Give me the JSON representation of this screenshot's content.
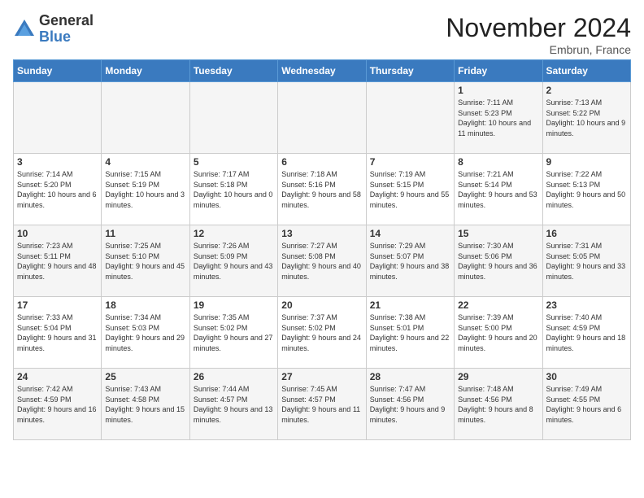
{
  "logo": {
    "general": "General",
    "blue": "Blue"
  },
  "title": "November 2024",
  "location": "Embrun, France",
  "days_of_week": [
    "Sunday",
    "Monday",
    "Tuesday",
    "Wednesday",
    "Thursday",
    "Friday",
    "Saturday"
  ],
  "weeks": [
    [
      {
        "num": "",
        "content": ""
      },
      {
        "num": "",
        "content": ""
      },
      {
        "num": "",
        "content": ""
      },
      {
        "num": "",
        "content": ""
      },
      {
        "num": "",
        "content": ""
      },
      {
        "num": "1",
        "content": "Sunrise: 7:11 AM\nSunset: 5:23 PM\nDaylight: 10 hours and 11 minutes."
      },
      {
        "num": "2",
        "content": "Sunrise: 7:13 AM\nSunset: 5:22 PM\nDaylight: 10 hours and 9 minutes."
      }
    ],
    [
      {
        "num": "3",
        "content": "Sunrise: 7:14 AM\nSunset: 5:20 PM\nDaylight: 10 hours and 6 minutes."
      },
      {
        "num": "4",
        "content": "Sunrise: 7:15 AM\nSunset: 5:19 PM\nDaylight: 10 hours and 3 minutes."
      },
      {
        "num": "5",
        "content": "Sunrise: 7:17 AM\nSunset: 5:18 PM\nDaylight: 10 hours and 0 minutes."
      },
      {
        "num": "6",
        "content": "Sunrise: 7:18 AM\nSunset: 5:16 PM\nDaylight: 9 hours and 58 minutes."
      },
      {
        "num": "7",
        "content": "Sunrise: 7:19 AM\nSunset: 5:15 PM\nDaylight: 9 hours and 55 minutes."
      },
      {
        "num": "8",
        "content": "Sunrise: 7:21 AM\nSunset: 5:14 PM\nDaylight: 9 hours and 53 minutes."
      },
      {
        "num": "9",
        "content": "Sunrise: 7:22 AM\nSunset: 5:13 PM\nDaylight: 9 hours and 50 minutes."
      }
    ],
    [
      {
        "num": "10",
        "content": "Sunrise: 7:23 AM\nSunset: 5:11 PM\nDaylight: 9 hours and 48 minutes."
      },
      {
        "num": "11",
        "content": "Sunrise: 7:25 AM\nSunset: 5:10 PM\nDaylight: 9 hours and 45 minutes."
      },
      {
        "num": "12",
        "content": "Sunrise: 7:26 AM\nSunset: 5:09 PM\nDaylight: 9 hours and 43 minutes."
      },
      {
        "num": "13",
        "content": "Sunrise: 7:27 AM\nSunset: 5:08 PM\nDaylight: 9 hours and 40 minutes."
      },
      {
        "num": "14",
        "content": "Sunrise: 7:29 AM\nSunset: 5:07 PM\nDaylight: 9 hours and 38 minutes."
      },
      {
        "num": "15",
        "content": "Sunrise: 7:30 AM\nSunset: 5:06 PM\nDaylight: 9 hours and 36 minutes."
      },
      {
        "num": "16",
        "content": "Sunrise: 7:31 AM\nSunset: 5:05 PM\nDaylight: 9 hours and 33 minutes."
      }
    ],
    [
      {
        "num": "17",
        "content": "Sunrise: 7:33 AM\nSunset: 5:04 PM\nDaylight: 9 hours and 31 minutes."
      },
      {
        "num": "18",
        "content": "Sunrise: 7:34 AM\nSunset: 5:03 PM\nDaylight: 9 hours and 29 minutes."
      },
      {
        "num": "19",
        "content": "Sunrise: 7:35 AM\nSunset: 5:02 PM\nDaylight: 9 hours and 27 minutes."
      },
      {
        "num": "20",
        "content": "Sunrise: 7:37 AM\nSunset: 5:02 PM\nDaylight: 9 hours and 24 minutes."
      },
      {
        "num": "21",
        "content": "Sunrise: 7:38 AM\nSunset: 5:01 PM\nDaylight: 9 hours and 22 minutes."
      },
      {
        "num": "22",
        "content": "Sunrise: 7:39 AM\nSunset: 5:00 PM\nDaylight: 9 hours and 20 minutes."
      },
      {
        "num": "23",
        "content": "Sunrise: 7:40 AM\nSunset: 4:59 PM\nDaylight: 9 hours and 18 minutes."
      }
    ],
    [
      {
        "num": "24",
        "content": "Sunrise: 7:42 AM\nSunset: 4:59 PM\nDaylight: 9 hours and 16 minutes."
      },
      {
        "num": "25",
        "content": "Sunrise: 7:43 AM\nSunset: 4:58 PM\nDaylight: 9 hours and 15 minutes."
      },
      {
        "num": "26",
        "content": "Sunrise: 7:44 AM\nSunset: 4:57 PM\nDaylight: 9 hours and 13 minutes."
      },
      {
        "num": "27",
        "content": "Sunrise: 7:45 AM\nSunset: 4:57 PM\nDaylight: 9 hours and 11 minutes."
      },
      {
        "num": "28",
        "content": "Sunrise: 7:47 AM\nSunset: 4:56 PM\nDaylight: 9 hours and 9 minutes."
      },
      {
        "num": "29",
        "content": "Sunrise: 7:48 AM\nSunset: 4:56 PM\nDaylight: 9 hours and 8 minutes."
      },
      {
        "num": "30",
        "content": "Sunrise: 7:49 AM\nSunset: 4:55 PM\nDaylight: 9 hours and 6 minutes."
      }
    ]
  ]
}
